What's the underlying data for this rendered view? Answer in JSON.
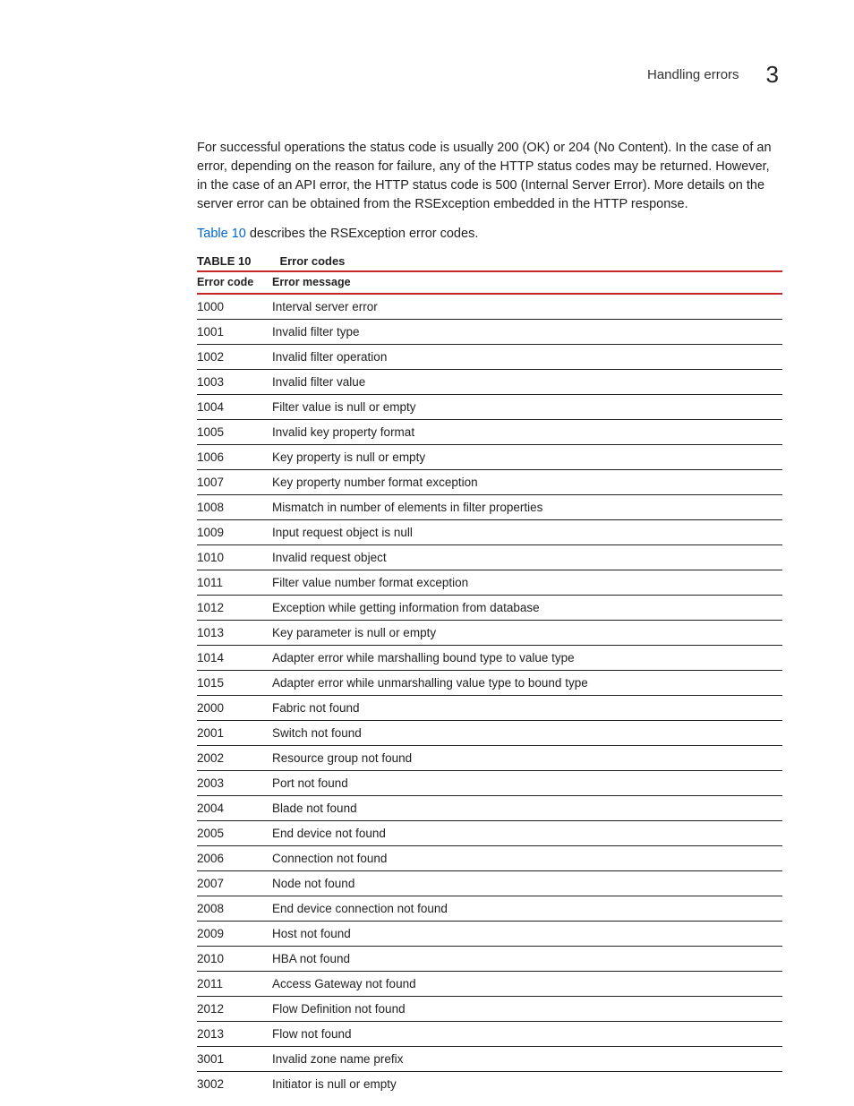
{
  "header": {
    "section_title": "Handling errors",
    "chapter_number": "3"
  },
  "paragraphs": {
    "p1": "For successful operations the status code is usually 200 (OK) or 204 (No Content). In the case of an error, depending on the reason for failure, any of the HTTP status codes may be returned. However, in the case of an API error, the HTTP status code is 500 (Internal Server Error). More details on the server error can be obtained from the RSException embedded in the HTTP response.",
    "p2_link": "Table 10",
    "p2_rest": " describes the RSException error codes."
  },
  "table": {
    "label": "TABLE 10",
    "title": "Error codes",
    "columns": {
      "code": "Error code",
      "message": "Error message"
    },
    "rows": [
      {
        "code": "1000",
        "message": "Interval server error"
      },
      {
        "code": "1001",
        "message": "Invalid filter type"
      },
      {
        "code": "1002",
        "message": "Invalid filter operation"
      },
      {
        "code": "1003",
        "message": "Invalid filter value"
      },
      {
        "code": "1004",
        "message": "Filter value is null or empty"
      },
      {
        "code": "1005",
        "message": "Invalid key property format"
      },
      {
        "code": "1006",
        "message": "Key property is null or empty"
      },
      {
        "code": "1007",
        "message": "Key property number format exception"
      },
      {
        "code": "1008",
        "message": "Mismatch in number of elements in filter properties"
      },
      {
        "code": "1009",
        "message": "Input request object is null"
      },
      {
        "code": "1010",
        "message": "Invalid request object"
      },
      {
        "code": "1011",
        "message": "Filter value number format exception"
      },
      {
        "code": "1012",
        "message": "Exception while getting information from database"
      },
      {
        "code": "1013",
        "message": "Key parameter is null or empty"
      },
      {
        "code": "1014",
        "message": "Adapter error while marshalling bound type to value type"
      },
      {
        "code": "1015",
        "message": "Adapter error while unmarshalling value type to bound type"
      },
      {
        "code": "2000",
        "message": "Fabric not found"
      },
      {
        "code": "2001",
        "message": "Switch not found"
      },
      {
        "code": "2002",
        "message": "Resource group not found"
      },
      {
        "code": "2003",
        "message": "Port not found"
      },
      {
        "code": "2004",
        "message": "Blade not found"
      },
      {
        "code": "2005",
        "message": "End device not found"
      },
      {
        "code": "2006",
        "message": "Connection not found"
      },
      {
        "code": "2007",
        "message": "Node not found"
      },
      {
        "code": "2008",
        "message": "End device connection not found"
      },
      {
        "code": "2009",
        "message": "Host not found"
      },
      {
        "code": "2010",
        "message": "HBA not found"
      },
      {
        "code": "2011",
        "message": "Access Gateway not found"
      },
      {
        "code": "2012",
        "message": "Flow Definition not found"
      },
      {
        "code": "2013",
        "message": "Flow not found"
      },
      {
        "code": "3001",
        "message": "Invalid zone name prefix"
      },
      {
        "code": "3002",
        "message": "Initiator is null or empty"
      }
    ]
  }
}
